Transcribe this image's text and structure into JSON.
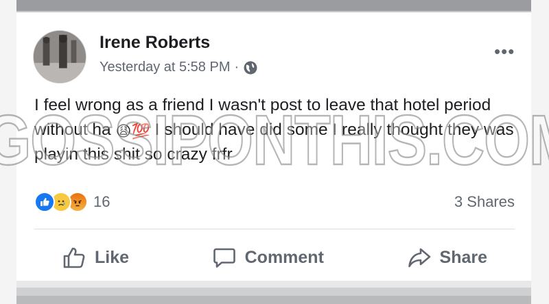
{
  "post": {
    "author_name": "Irene Roberts",
    "timestamp": "Yesterday at 5:58 PM",
    "separator": "·",
    "privacy_icon": "globe-icon",
    "menu_label": "•••",
    "text_part1": "I feel wrong as a friend I wasn't post to leave that hotel period without ha ",
    "emoji_weary": "😩",
    "emoji_100": "💯",
    "text_part2": "I should have did some I really thought they was playin this shit so crazy frfr",
    "reactions": {
      "types": [
        "like-icon",
        "sad-icon",
        "angry-icon"
      ],
      "count": "16"
    },
    "shares_label": "3 Shares"
  },
  "actions": {
    "like_label": "Like",
    "comment_label": "Comment",
    "share_label": "Share"
  },
  "watermark": "GOSSIPONTHIS.COM",
  "colors": {
    "text_primary": "#1c1e21",
    "text_secondary": "#606770",
    "like_blue": "#1877f2",
    "sad_yellow": "#f7c940",
    "angry_orange": "#e9710f"
  }
}
